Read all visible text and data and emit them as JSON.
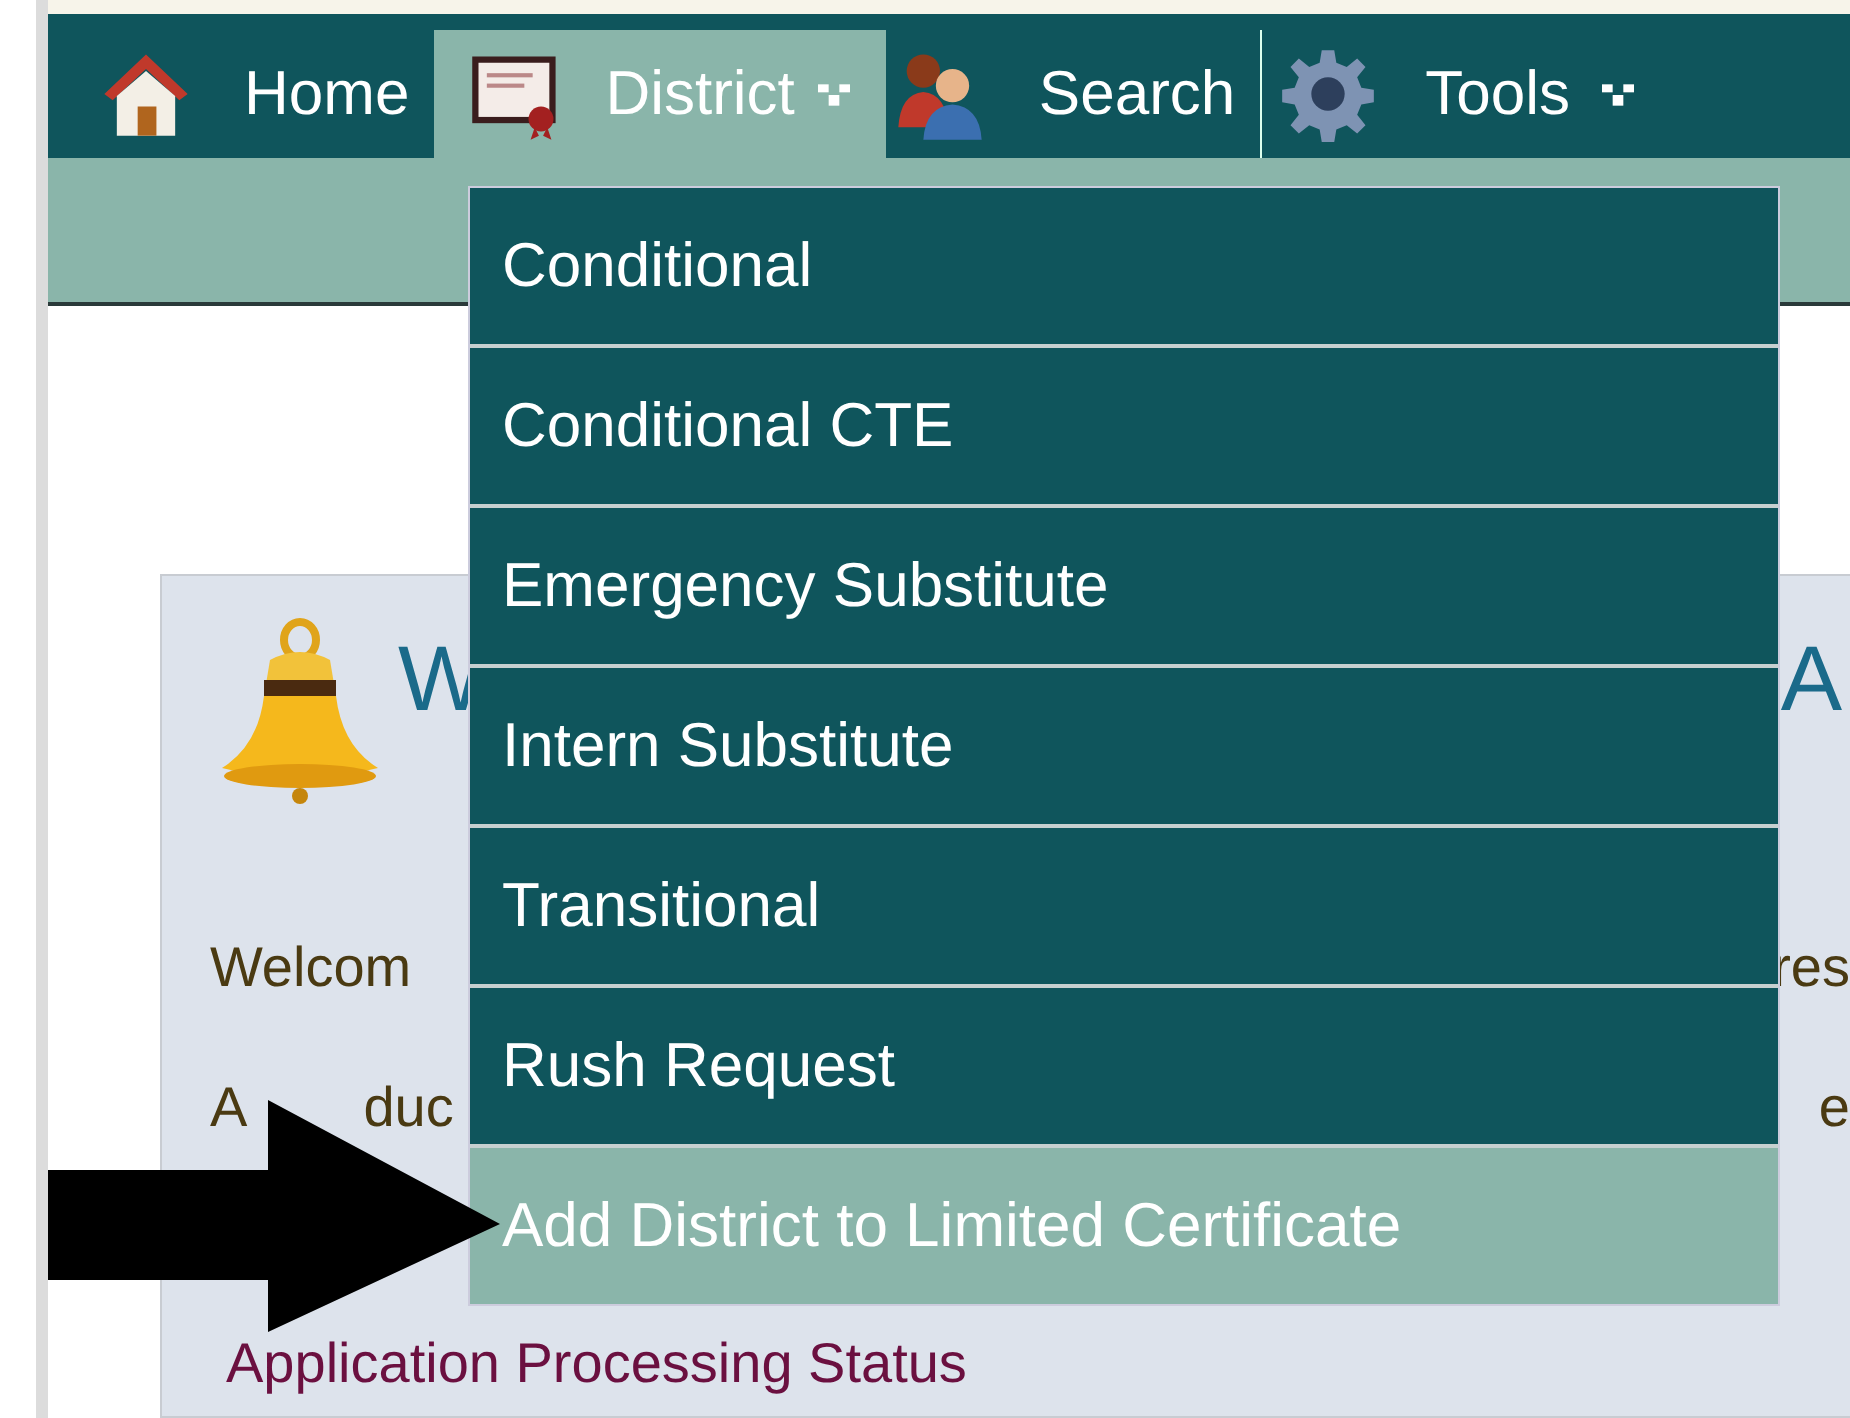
{
  "nav": {
    "items": [
      {
        "label": "Home",
        "selected": false,
        "has_menu": false
      },
      {
        "label": "District",
        "selected": true,
        "has_menu": true
      },
      {
        "label": "Search",
        "selected": false,
        "has_menu": false
      },
      {
        "label": "Tools",
        "selected": false,
        "has_menu": true
      }
    ]
  },
  "dropdown": {
    "items": [
      {
        "label": "Conditional",
        "selected": false
      },
      {
        "label": "Conditional CTE",
        "selected": false
      },
      {
        "label": "Emergency Substitute",
        "selected": false
      },
      {
        "label": "Intern Substitute",
        "selected": false
      },
      {
        "label": "Transitional",
        "selected": false
      },
      {
        "label": "Rush Request",
        "selected": false
      },
      {
        "label": "Add District to Limited Certificate",
        "selected": true
      }
    ]
  },
  "panel": {
    "heading_left": "W",
    "heading_right": "A",
    "lines": [
      {
        "left": [
          "Welcom"
        ],
        "right": "res"
      },
      {
        "left": [
          "A",
          "duc"
        ],
        "right": "e"
      }
    ],
    "link": "Application Processing Status"
  }
}
